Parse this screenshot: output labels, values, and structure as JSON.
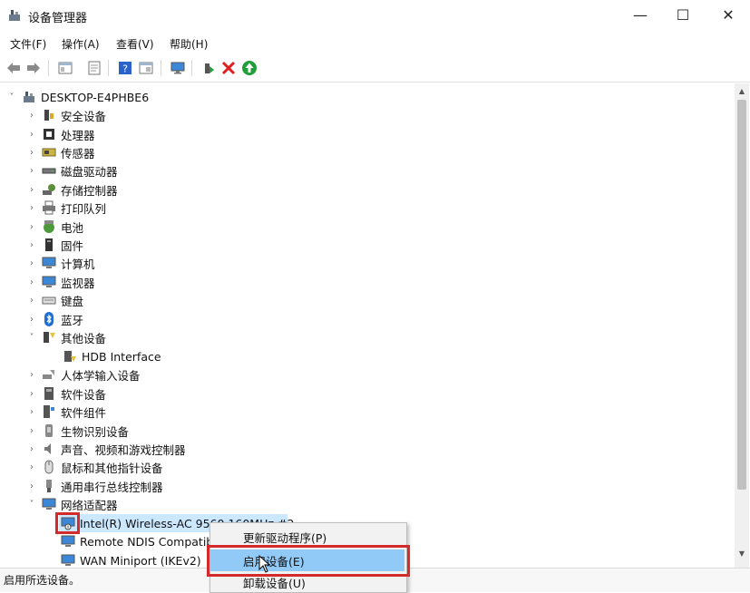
{
  "window": {
    "title": "设备管理器"
  },
  "menu": [
    "文件(F)",
    "操作(A)",
    "查看(V)",
    "帮助(H)"
  ],
  "toolbar": {
    "buttons": [
      "back-icon",
      "forward-icon",
      "show-hide-icon",
      "properties-icon",
      "help-icon",
      "view-icon",
      "monitor-icon",
      "update-driver-icon",
      "uninstall-icon",
      "enable-icon"
    ],
    "colors": {
      "uninstall": "#e02020",
      "enable": "#1f9e3a"
    }
  },
  "tree": {
    "root": "DESKTOP-E4PHBE6",
    "items": [
      {
        "label": "安全设备",
        "icon": "security-device-icon"
      },
      {
        "label": "处理器",
        "icon": "processor-icon"
      },
      {
        "label": "传感器",
        "icon": "sensor-icon"
      },
      {
        "label": "磁盘驱动器",
        "icon": "disk-drive-icon"
      },
      {
        "label": "存储控制器",
        "icon": "storage-controller-icon"
      },
      {
        "label": "打印队列",
        "icon": "print-queue-icon"
      },
      {
        "label": "电池",
        "icon": "battery-icon"
      },
      {
        "label": "固件",
        "icon": "firmware-icon"
      },
      {
        "label": "计算机",
        "icon": "computer-icon"
      },
      {
        "label": "监视器",
        "icon": "monitor-icon"
      },
      {
        "label": "键盘",
        "icon": "keyboard-icon"
      },
      {
        "label": "蓝牙",
        "icon": "bluetooth-icon"
      },
      {
        "label": "其他设备",
        "icon": "other-device-icon",
        "expanded": true
      },
      {
        "label": "HDB Interface",
        "icon": "unknown-device-icon",
        "child": true
      },
      {
        "label": "人体学输入设备",
        "icon": "hid-icon"
      },
      {
        "label": "软件设备",
        "icon": "software-device-icon"
      },
      {
        "label": "软件组件",
        "icon": "software-component-icon"
      },
      {
        "label": "生物识别设备",
        "icon": "biometric-icon"
      },
      {
        "label": "声音、视频和游戏控制器",
        "icon": "sound-icon"
      },
      {
        "label": "鼠标和其他指针设备",
        "icon": "mouse-icon"
      },
      {
        "label": "通用串行总线控制器",
        "icon": "usb-icon"
      },
      {
        "label": "网络适配器",
        "icon": "network-adapter-icon",
        "expanded": true
      },
      {
        "label": "Intel(R) Wireless-AC 9560 160MHz #2",
        "icon": "disabled-adapter-icon",
        "child": true,
        "selected": true
      },
      {
        "label": "Remote NDIS Compatible Device",
        "icon": "adapter-icon",
        "child": true
      },
      {
        "label": "WAN Miniport (IKEv2)",
        "icon": "adapter-icon",
        "child": true
      }
    ]
  },
  "context_menu": {
    "items": [
      "更新驱动程序(P)",
      "启用设备(E)",
      "卸载设备(U)"
    ],
    "hovered": "启用设备(E)"
  },
  "status": {
    "text": "启用所选设备。"
  },
  "colors": {
    "selection": "#cce8ff",
    "menu_hover": "#91c9f7",
    "annotation_box": "#d32b2b"
  }
}
